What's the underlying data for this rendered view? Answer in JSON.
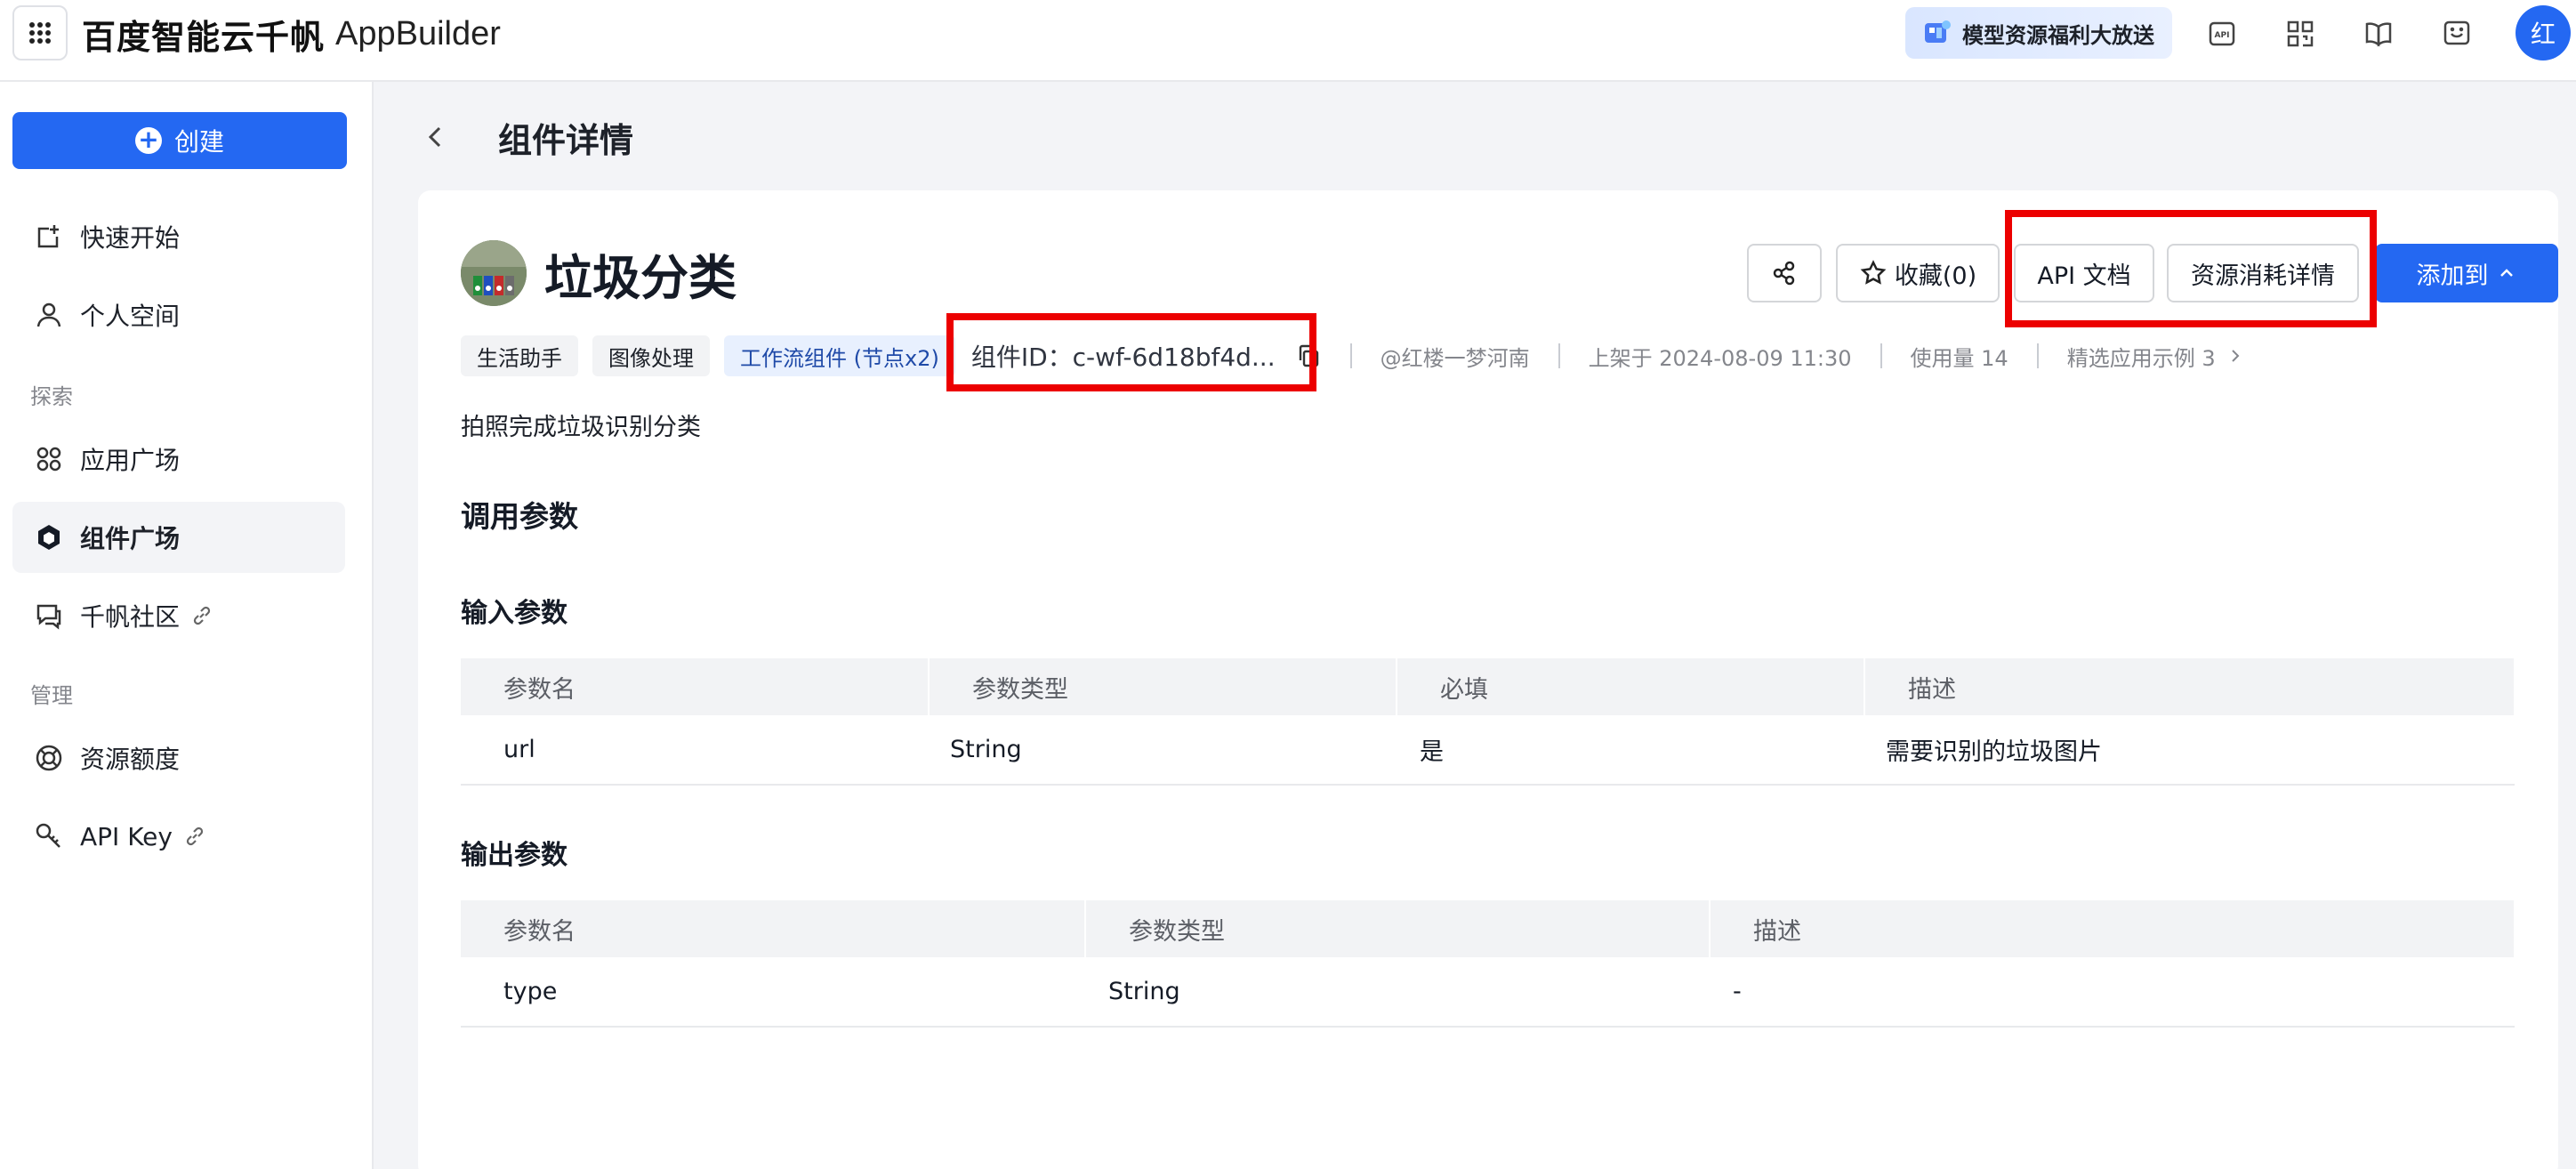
{
  "topbar": {
    "brand_cn": "百度智能云千帆",
    "brand_en": "AppBuilder",
    "promo": "模型资源福利大放送",
    "avatar": "红",
    "icons": [
      "api-icon",
      "qr-code-icon",
      "book-icon",
      "feedback-icon"
    ]
  },
  "sidebar": {
    "create_label": "创建",
    "items": [
      {
        "label": "快速开始",
        "icon": "quick-start-icon"
      },
      {
        "label": "个人空间",
        "icon": "user-icon"
      },
      {
        "label": "应用广场",
        "icon": "apps-icon"
      },
      {
        "label": "组件广场",
        "icon": "component-icon"
      },
      {
        "label": "千帆社区",
        "icon": "community-icon"
      },
      {
        "label": "资源额度",
        "icon": "resource-icon"
      },
      {
        "label": "API Key",
        "icon": "key-icon"
      }
    ],
    "sections": {
      "explore": "探索",
      "manage": "管理"
    }
  },
  "page": {
    "title": "组件详情"
  },
  "component": {
    "name": "垃圾分类",
    "tags": [
      "生活助手",
      "图像处理",
      "工作流组件 (节点x2)"
    ],
    "id_label": "组件ID：c-wf-6d18bf4d...",
    "author": "@红楼一梦河南",
    "published": "上架于 2024-08-09 11:30",
    "usage": "使用量 14",
    "examples": "精选应用示例 3",
    "description": "拍照完成垃圾识别分类",
    "buttons": {
      "favorite": "收藏(0)",
      "api_doc": "API 文档",
      "resource_detail": "资源消耗详情",
      "add_to": "添加到"
    }
  },
  "params": {
    "section_title": "调用参数",
    "input": {
      "title": "输入参数",
      "headers": [
        "参数名",
        "参数类型",
        "必填",
        "描述"
      ],
      "rows": [
        [
          "url",
          "String",
          "是",
          "需要识别的垃圾图片"
        ]
      ]
    },
    "output": {
      "title": "输出参数",
      "headers": [
        "参数名",
        "参数类型",
        "描述"
      ],
      "rows": [
        [
          "type",
          "String",
          "-"
        ]
      ]
    }
  },
  "colors": {
    "accent": "#2468f2",
    "highlight": "#ec0000"
  }
}
